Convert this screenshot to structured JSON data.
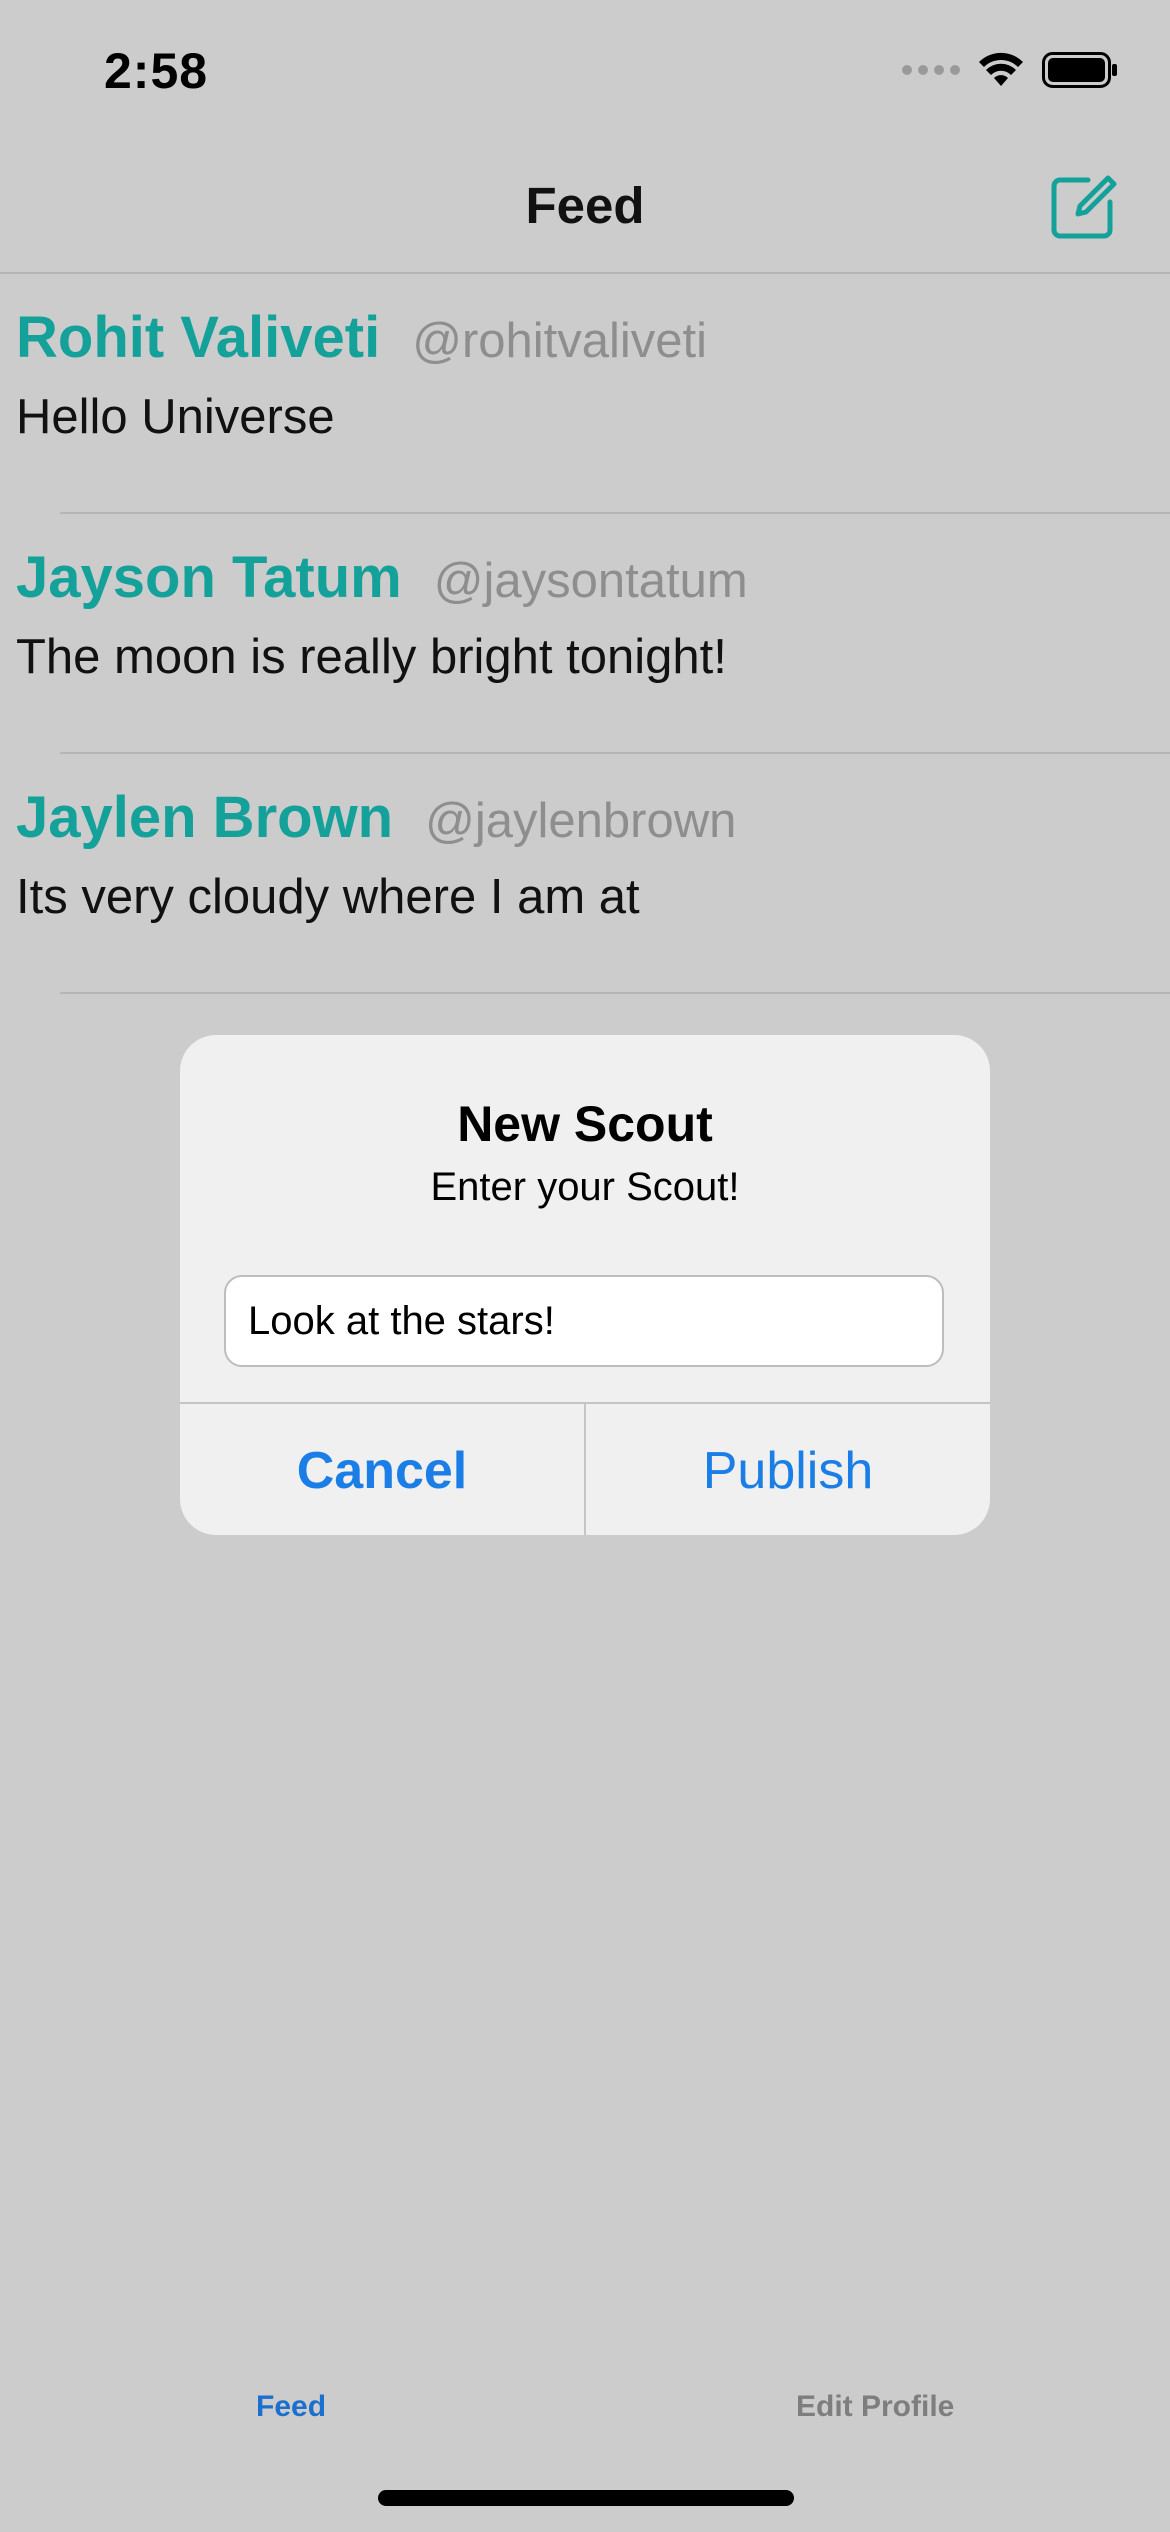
{
  "status_bar": {
    "time": "2:58"
  },
  "nav": {
    "title": "Feed",
    "compose_icon": "compose-icon",
    "accent_color": "#14a19a"
  },
  "feed": {
    "posts": [
      {
        "name": "Rohit Valiveti",
        "handle": "@rohitvaliveti",
        "text": "Hello Universe"
      },
      {
        "name": "Jayson Tatum",
        "handle": "@jaysontatum",
        "text": "The moon is really bright tonight!"
      },
      {
        "name": "Jaylen Brown",
        "handle": "@jaylenbrown",
        "text": "Its very cloudy where I am at"
      }
    ]
  },
  "alert": {
    "title": "New Scout",
    "message": "Enter your Scout!",
    "input_value": "Look at the stars!",
    "cancel_label": "Cancel",
    "publish_label": "Publish",
    "button_color": "#1a7ee6"
  },
  "tabs": {
    "feed_label": "Feed",
    "edit_profile_label": "Edit Profile"
  }
}
